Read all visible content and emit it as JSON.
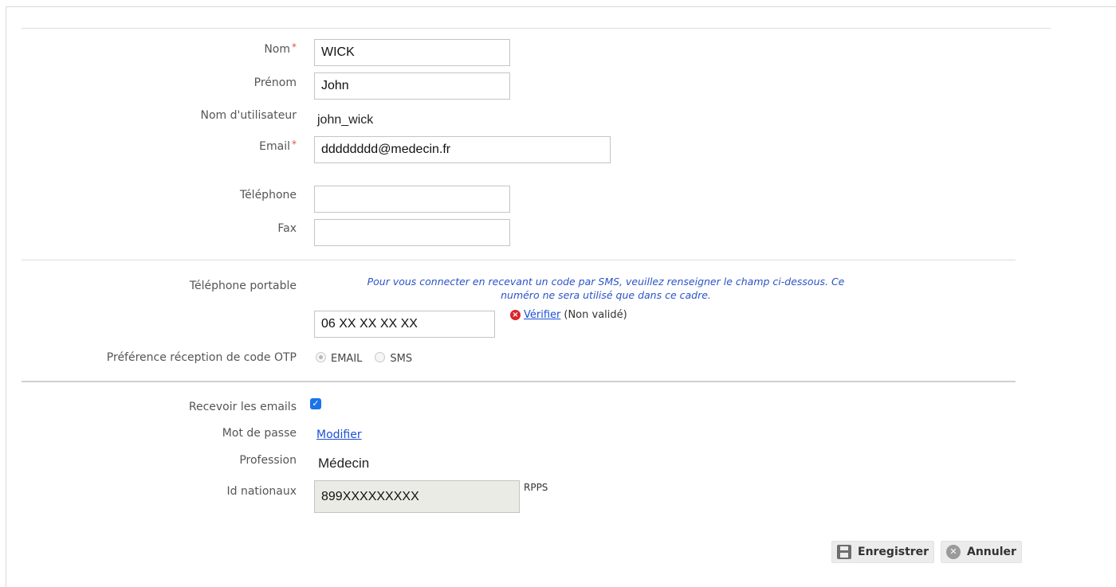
{
  "fields": {
    "nom": {
      "label": "Nom",
      "required": "*",
      "value": "WICK"
    },
    "prenom": {
      "label": "Prénom",
      "value": "John"
    },
    "username": {
      "label": "Nom d'utilisateur",
      "value": "john_wick"
    },
    "email": {
      "label": "Email",
      "required": "*",
      "value": "dddddddd@medecin.fr"
    },
    "telephone": {
      "label": "Téléphone",
      "value": ""
    },
    "fax": {
      "label": "Fax",
      "value": ""
    }
  },
  "mobile": {
    "label": "Téléphone portable",
    "info_line1": "Pour vous connecter en recevant un code par SMS, veuillez renseigner le champ ci-dessous. Ce",
    "info_line2": "numéro ne sera utilisé que dans ce cadre.",
    "value": "06 XX XX XX XX",
    "verify_link": "Vérifier",
    "status": "(Non validé)"
  },
  "otp": {
    "label": "Préférence réception de code OTP",
    "options": [
      "EMAIL",
      "SMS"
    ],
    "selected": "EMAIL"
  },
  "receive_emails": {
    "label": "Recevoir les emails",
    "checked": true
  },
  "password": {
    "label": "Mot de passe",
    "link": "Modifier"
  },
  "profession": {
    "label": "Profession",
    "value": "Médecin"
  },
  "national_id": {
    "label": "Id nationaux",
    "value": "899XXXXXXXXX",
    "type": "RPPS"
  },
  "actions": {
    "save": "Enregistrer",
    "cancel": "Annuler"
  },
  "colors": {
    "required": "#d9534f",
    "info": "#2c53c7",
    "link": "#1a4fd6",
    "checkbox": "#1a73e8",
    "error": "#d9242b"
  }
}
